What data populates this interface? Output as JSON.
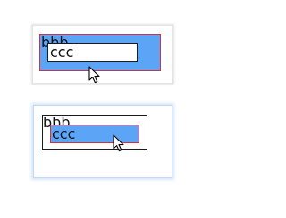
{
  "top_example": {
    "outer_text": "bbb",
    "inner_text": "ccc"
  },
  "bottom_example": {
    "outer_text": "bbb",
    "inner_text": "ccc"
  },
  "colors": {
    "highlight_fill": "#5ca5f6",
    "highlight_border": "#d0323b",
    "plain_border": "#1b1b1b",
    "focus_glow": "#c3d8f3"
  },
  "icons": {
    "pointer": "mouse-pointer-icon"
  }
}
